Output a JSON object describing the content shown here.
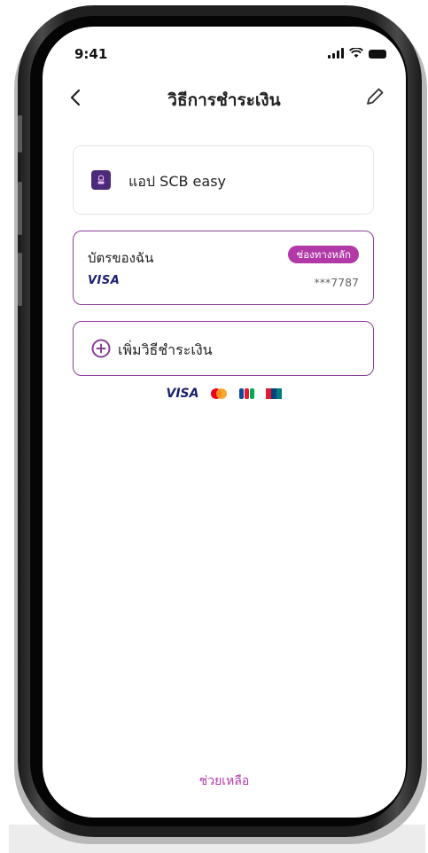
{
  "status_bar": {
    "time": "9:41"
  },
  "header": {
    "title": "วิธีการชำระเงิน"
  },
  "payment_methods": {
    "scb_app": {
      "label": "แอป SCB easy"
    },
    "my_card": {
      "label": "บัตรของฉัน",
      "default_badge": "ช่องทางหลัก",
      "brand": "VISA",
      "masked_number": "***7787"
    },
    "add_method": {
      "label": "เพิ่มวิธีชำระเงิน"
    }
  },
  "supported_brands": {
    "visa": "VISA",
    "icons": [
      "mastercard-icon",
      "jcb-icon",
      "unionpay-icon"
    ]
  },
  "footer": {
    "help_link": "ช่วยเหลือ"
  },
  "colors": {
    "accent": "#b23aa8",
    "border_active": "#8a3e96",
    "visa_blue": "#1a1f71",
    "scb_purple": "#4b2a7a"
  }
}
